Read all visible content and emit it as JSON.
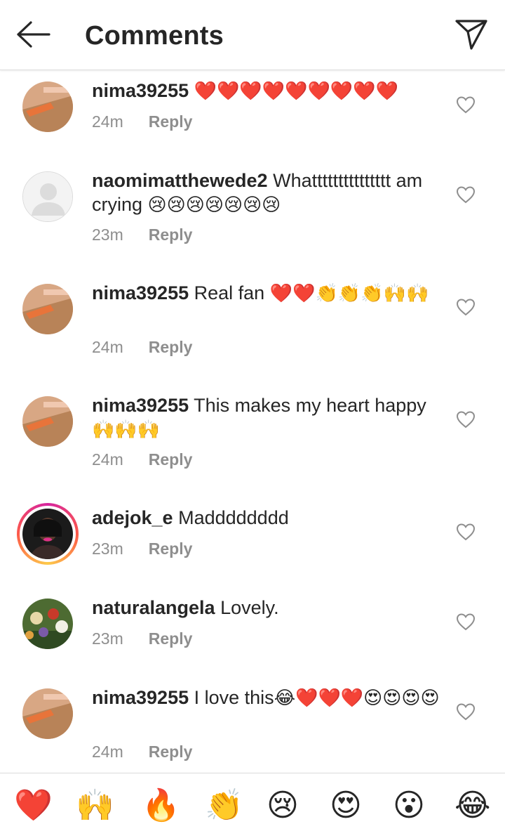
{
  "header": {
    "title": "Comments",
    "back_icon": "arrow-left-icon",
    "send_icon": "paper-plane-icon"
  },
  "reply_label": "Reply",
  "comments": [
    {
      "username": "nima39255",
      "text": "",
      "emojis": "❤️❤️❤️❤️❤️❤️❤️❤️❤️",
      "time": "24m",
      "avatar": "sand-orange"
    },
    {
      "username": "naomimatthewede2",
      "text": "Whattttttttttttttt am crying",
      "emojis": "😢😢😢😢😢😢😢",
      "time": "23m",
      "avatar": "default-gray"
    },
    {
      "username": "nima39255",
      "text": "Real fan",
      "emojis": "❤️❤️👏👏👏🙌🙌",
      "time": "24m",
      "avatar": "sand-orange"
    },
    {
      "username": "nima39255",
      "text": "This makes my heart happy",
      "emojis": "🙌🙌🙌",
      "time": "24m",
      "avatar": "sand-orange"
    },
    {
      "username": "adejok_e",
      "text": "Madddddddd",
      "emojis": "",
      "time": "23m",
      "avatar": "portrait-story-ring"
    },
    {
      "username": "naturalangela",
      "text": "Lovely.",
      "emojis": "",
      "time": "23m",
      "avatar": "flowers"
    },
    {
      "username": "nima39255",
      "text": "I love this",
      "emojis": "😂❤️❤️❤️😍😍😍😍",
      "time": "24m",
      "avatar": "sand-orange"
    }
  ],
  "quick_reactions": [
    "❤️",
    "🙌",
    "🔥",
    "👏",
    "😢",
    "😍",
    "😮",
    "😂"
  ],
  "colors": {
    "text": "#262626",
    "meta": "#8e8e8e",
    "divider": "#dbdbdb",
    "heart": "#e0152a"
  }
}
